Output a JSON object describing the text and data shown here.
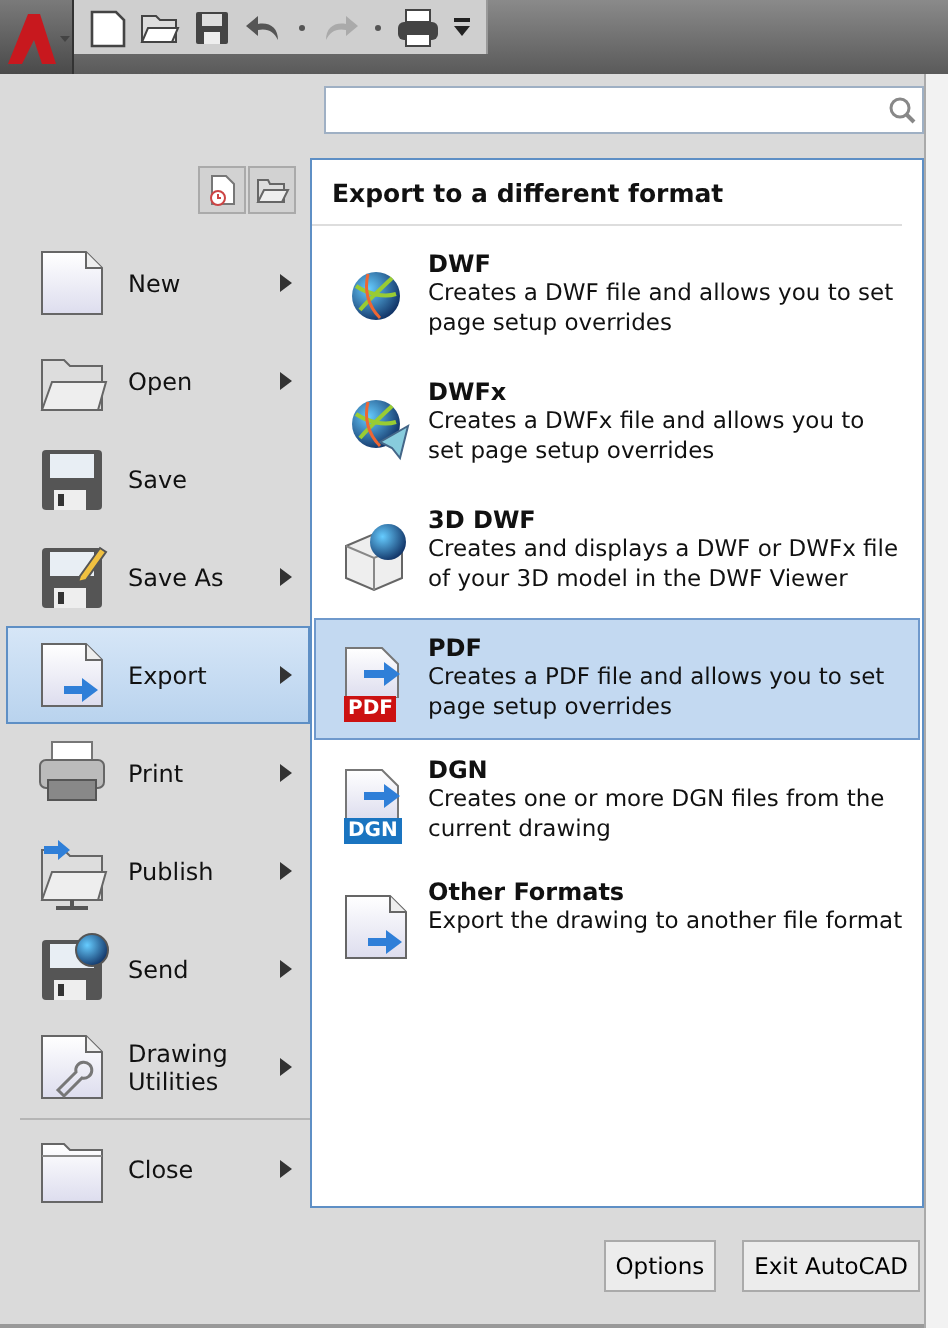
{
  "menu_items": [
    {
      "label": "New",
      "submenu": true,
      "selected": false
    },
    {
      "label": "Open",
      "submenu": true,
      "selected": false
    },
    {
      "label": "Save",
      "submenu": false,
      "selected": false
    },
    {
      "label": "Save As",
      "submenu": true,
      "selected": false
    },
    {
      "label": "Export",
      "submenu": true,
      "selected": true
    },
    {
      "label": "Print",
      "submenu": true,
      "selected": false
    },
    {
      "label": "Publish",
      "submenu": true,
      "selected": false
    },
    {
      "label": "Send",
      "submenu": true,
      "selected": false
    },
    {
      "label": "Drawing Utilities",
      "submenu": true,
      "selected": false
    },
    {
      "label": "Close",
      "submenu": true,
      "selected": false
    }
  ],
  "submenu": {
    "title": "Export to a different format",
    "items": [
      {
        "title": "DWF",
        "description": "Creates a DWF file and allows you to set page setup overrides",
        "selected": false
      },
      {
        "title": "DWFx",
        "description": "Creates a DWFx file and allows you to set page setup overrides",
        "selected": false
      },
      {
        "title": "3D DWF",
        "description": "Creates and displays a DWF or DWFx file of your 3D model in the DWF Viewer",
        "selected": false
      },
      {
        "title": "PDF",
        "description": "Creates a PDF file and allows you to set page setup overrides",
        "selected": true,
        "icon_label": "PDF"
      },
      {
        "title": "DGN",
        "description": "Creates one or more DGN files from the current drawing",
        "selected": false,
        "icon_label": "DGN"
      },
      {
        "title": "Other Formats",
        "description": "Export the drawing to another file format",
        "selected": false
      }
    ]
  },
  "buttons": [
    "Options",
    "Exit AutoCAD"
  ]
}
